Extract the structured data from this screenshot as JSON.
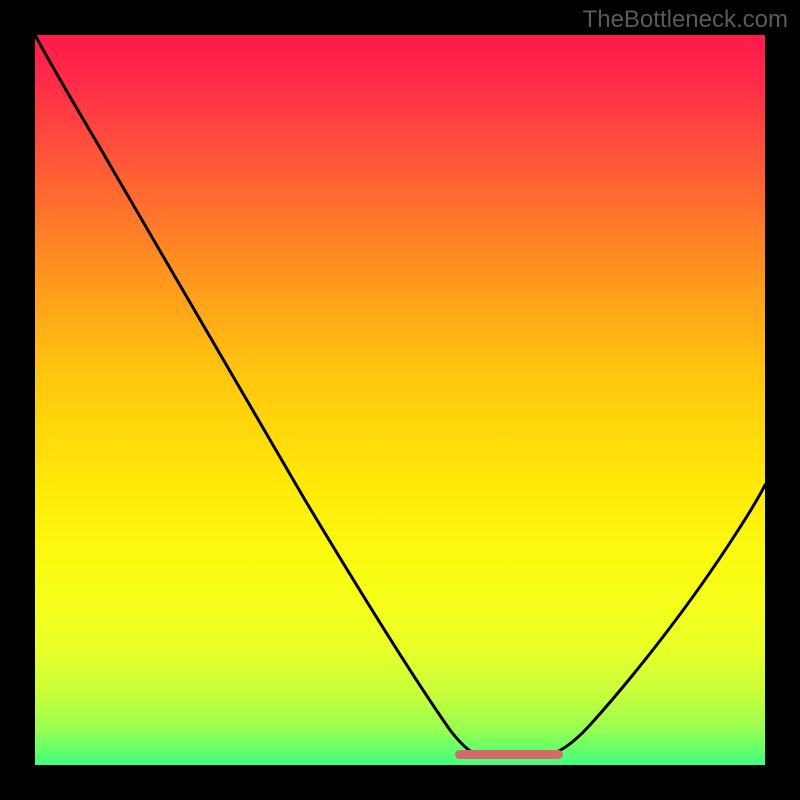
{
  "watermark": "TheBottleneck.com",
  "chart_data": {
    "type": "line",
    "title": "",
    "xlabel": "",
    "ylabel": "",
    "xlim": [
      0,
      100
    ],
    "ylim": [
      0,
      100
    ],
    "x": [
      0,
      5,
      10,
      15,
      20,
      25,
      30,
      35,
      40,
      45,
      50,
      55,
      58,
      60,
      62,
      65,
      68,
      70,
      75,
      80,
      85,
      90,
      95,
      100
    ],
    "y": [
      100,
      95,
      89,
      82,
      75,
      67,
      59,
      51,
      43,
      34,
      25,
      15,
      8,
      4,
      2,
      1,
      1,
      2,
      5,
      10,
      17,
      25,
      33,
      42
    ],
    "flat_segment": {
      "x_start": 58,
      "x_end": 72,
      "y": 1
    },
    "gradient_stops": [
      {
        "pos": 0,
        "color": "#ff1a4a"
      },
      {
        "pos": 50,
        "color": "#ffd400"
      },
      {
        "pos": 85,
        "color": "#e0ff2a"
      },
      {
        "pos": 100,
        "color": "#40ff80"
      }
    ]
  }
}
